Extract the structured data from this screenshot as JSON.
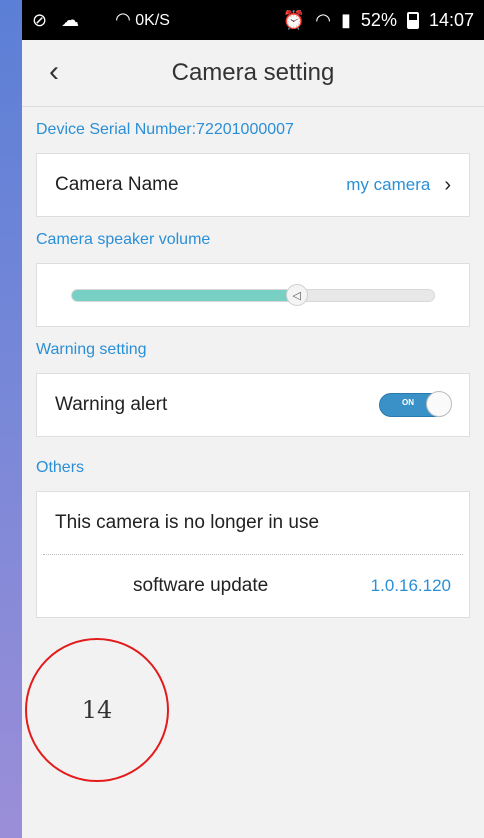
{
  "statusbar": {
    "net_speed": "0K/S",
    "battery": "52%",
    "time": "14:07"
  },
  "header": {
    "title": "Camera setting"
  },
  "device": {
    "serial_label": "Device Serial Number:72201000007"
  },
  "camera_name": {
    "label": "Camera Name",
    "value": "my camera"
  },
  "speaker": {
    "section": "Camera speaker volume",
    "volume_fraction": 0.62
  },
  "warning": {
    "section": "Warning setting",
    "alert_label": "Warning alert",
    "toggle_text": "ON",
    "enabled": true
  },
  "others": {
    "section": "Others",
    "no_longer_label": "This camera is no longer in use",
    "update_label": "software update",
    "update_version": "1.0.16.120"
  },
  "annotation": {
    "number": "14"
  },
  "colors": {
    "accent": "#2b8fd6",
    "slider_fill": "#78cfc4",
    "toggle_on": "#3a91c8",
    "annotation": "#e31b1b"
  }
}
